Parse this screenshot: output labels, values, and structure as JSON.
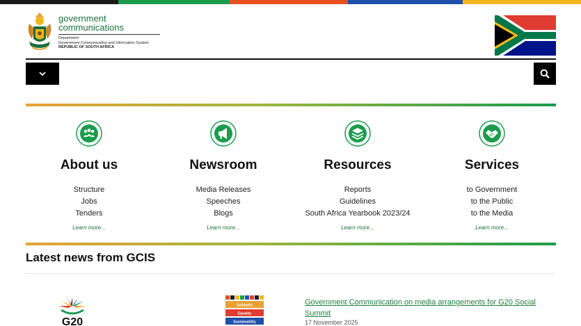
{
  "brand": {
    "name_line1": "government",
    "name_line2": "communications",
    "dept_line1": "Department:",
    "dept_line2": "Government Communication and Information System",
    "dept_line3": "REPUBLIC OF SOUTH AFRICA"
  },
  "colors": {
    "stripe": [
      "#1b1b1b",
      "#1a9c4c",
      "#e8501e",
      "#1f4fa8",
      "#f2b51d"
    ],
    "accent_green": "#1b6f3a",
    "link_green": "#1b7f3c"
  },
  "icons": {
    "menu": "chevron-down-icon",
    "search": "search-icon"
  },
  "sections": [
    {
      "title": "About us",
      "icon": "people-icon",
      "items": [
        "Structure",
        "Jobs",
        "Tenders"
      ],
      "more": "Learn more..."
    },
    {
      "title": "Newsroom",
      "icon": "megaphone-icon",
      "items": [
        "Media Releases",
        "Speeches",
        "Blogs"
      ],
      "more": "Learn more..."
    },
    {
      "title": "Resources",
      "icon": "layers-icon",
      "items": [
        "Reports",
        "Guidelines",
        "South Africa Yearbook 2023/24"
      ],
      "more": "Learn more..."
    },
    {
      "title": "Services",
      "icon": "handshake-icon",
      "items": [
        "to Government",
        "to the Public",
        "to the Media"
      ],
      "more": "Learn more..."
    }
  ],
  "latest": {
    "heading": "Latest news from GCIS",
    "g20_text": "G20",
    "sticker_labels": [
      "Solidarity",
      "Equality",
      "Sustainability"
    ],
    "news_title": "Government Communication on media arrangements for G20 Social Summit",
    "news_date": "17 November 2025"
  }
}
